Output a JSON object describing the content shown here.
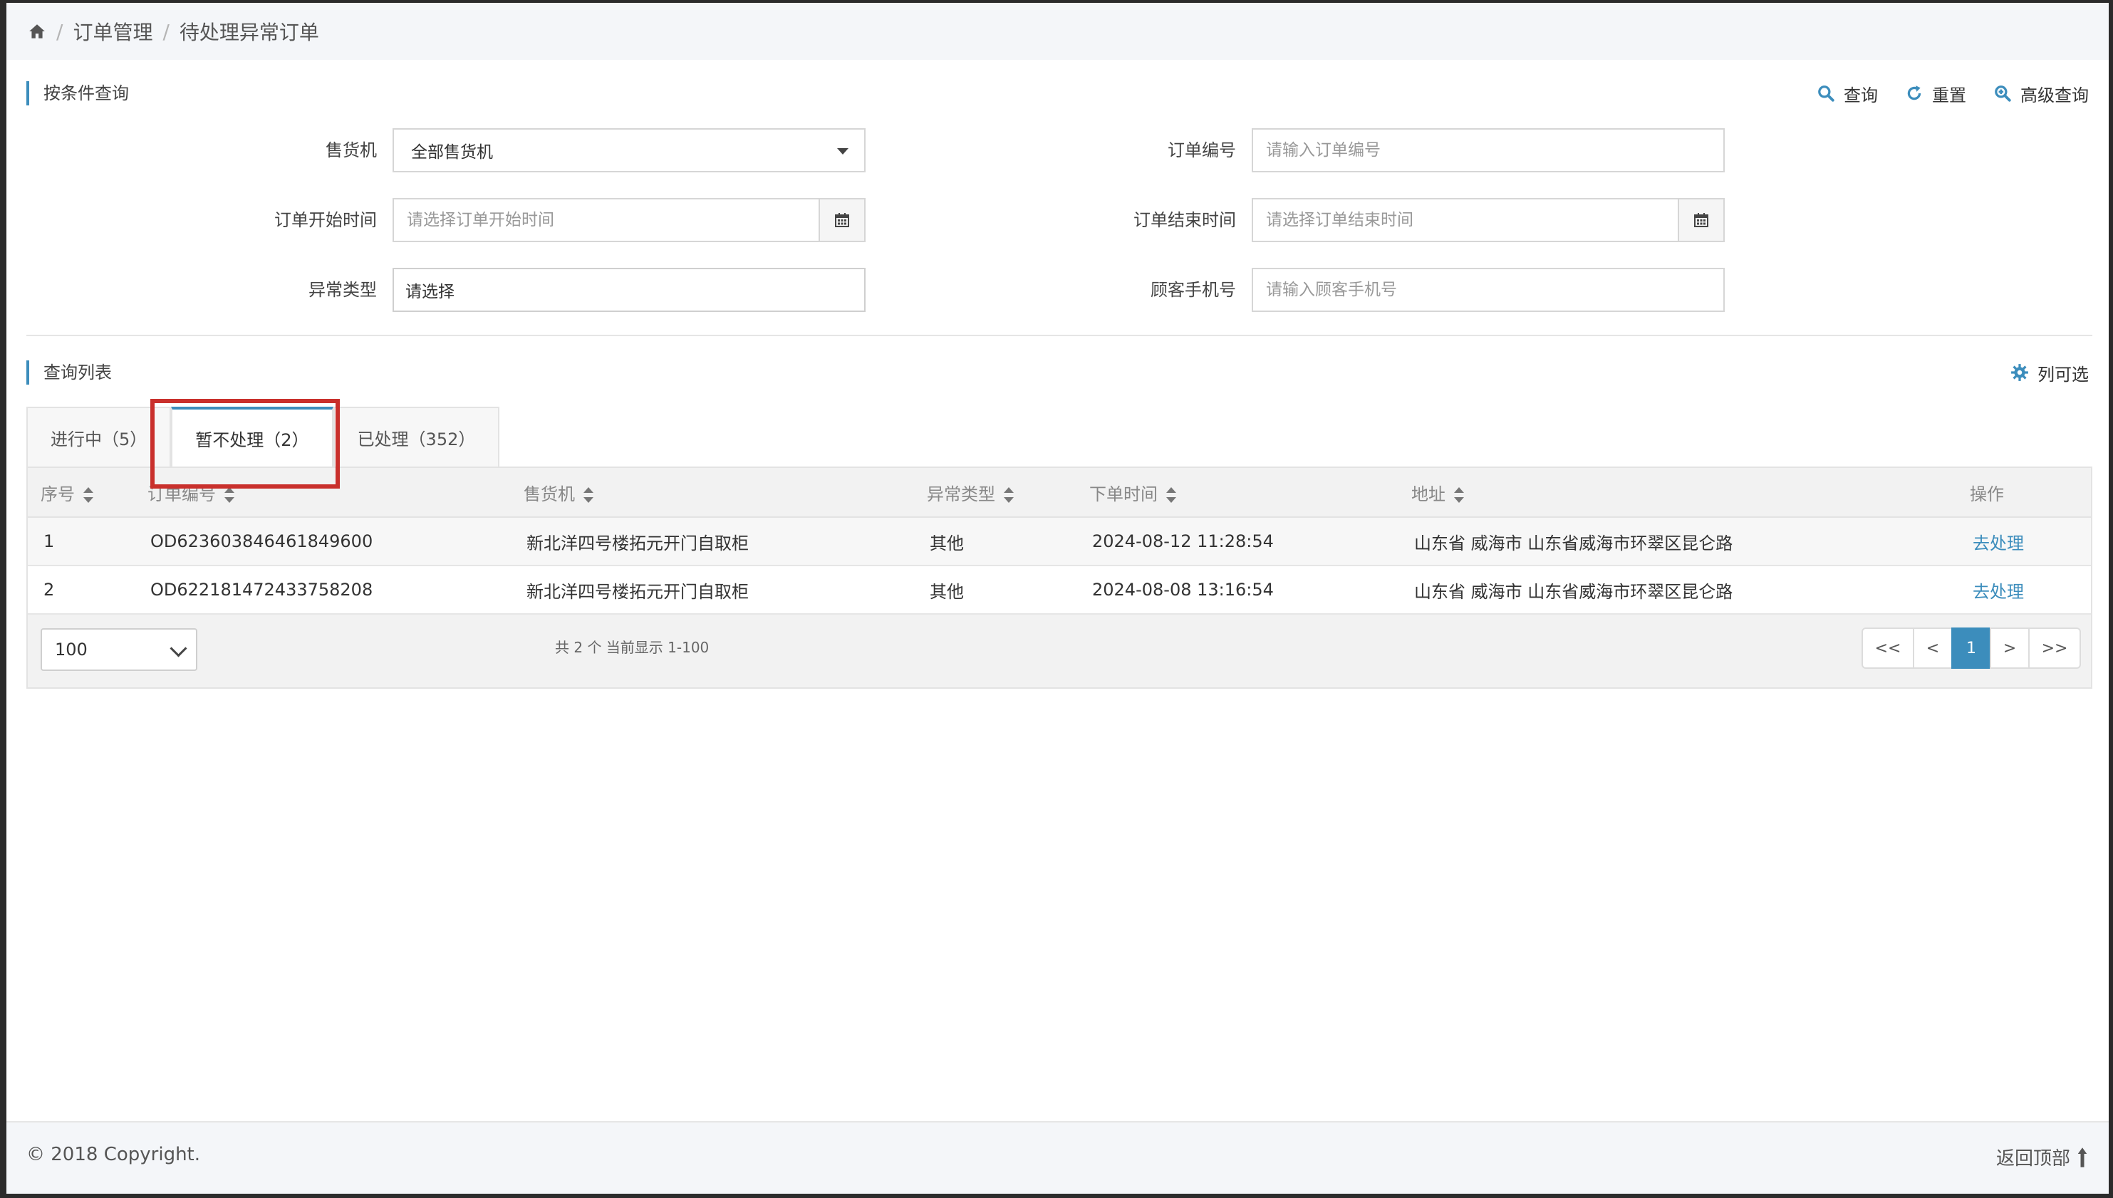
{
  "breadcrumb": {
    "items": [
      "订单管理",
      "待处理异常订单"
    ]
  },
  "search_section": {
    "title": "按条件查询",
    "actions": {
      "query": "查询",
      "reset": "重置",
      "advanced": "高级查询"
    }
  },
  "form": {
    "vending_machine": {
      "label": "售货机",
      "value": "全部售货机"
    },
    "order_no": {
      "label": "订单编号",
      "placeholder": "请输入订单编号"
    },
    "start_time": {
      "label": "订单开始时间",
      "placeholder": "请选择订单开始时间"
    },
    "end_time": {
      "label": "订单结束时间",
      "placeholder": "请选择订单结束时间"
    },
    "exception_type": {
      "label": "异常类型",
      "value": "请选择"
    },
    "customer_phone": {
      "label": "顾客手机号",
      "placeholder": "请输入顾客手机号"
    }
  },
  "list_section": {
    "title": "查询列表",
    "column_toggle": "列可选"
  },
  "tabs": [
    {
      "label": "进行中（5）",
      "active": false
    },
    {
      "label": "暂不处理（2）",
      "active": true
    },
    {
      "label": "已处理（352）",
      "active": false
    }
  ],
  "table": {
    "columns": [
      "序号",
      "订单编号",
      "售货机",
      "异常类型",
      "下单时间",
      "地址",
      "操作"
    ],
    "rows": [
      {
        "index": "1",
        "order_no": "OD623603846461849600",
        "machine": "新北洋四号楼拓元开门自取柜",
        "type": "其他",
        "time": "2024-08-12 11:28:54",
        "address": "山东省 威海市 山东省威海市环翠区昆仑路",
        "action": "去处理"
      },
      {
        "index": "2",
        "order_no": "OD622181472433758208",
        "machine": "新北洋四号楼拓元开门自取柜",
        "type": "其他",
        "time": "2024-08-08 13:16:54",
        "address": "山东省 威海市 山东省威海市环翠区昆仑路",
        "action": "去处理"
      }
    ]
  },
  "pagination": {
    "page_size": "100",
    "summary": "共 2 个 当前显示 1-100",
    "first": "<<",
    "prev": "<",
    "current": "1",
    "next": ">",
    "last": ">>"
  },
  "footer": {
    "copyright": "© 2018 Copyright.",
    "back_to_top": "返回顶部"
  },
  "colors": {
    "accent": "#3c8dbc",
    "highlight": "#c9302c"
  }
}
